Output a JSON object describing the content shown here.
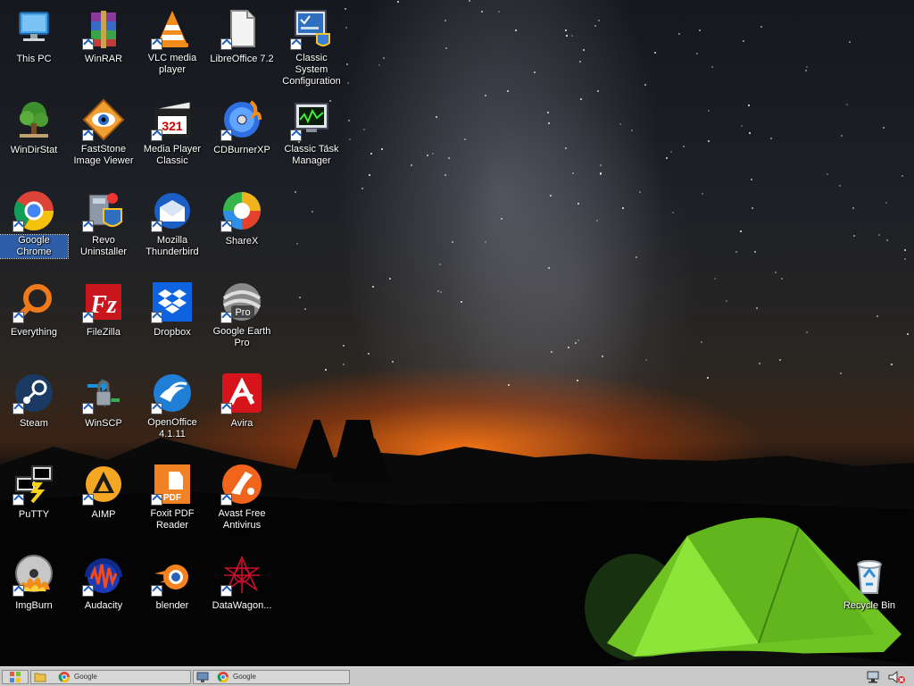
{
  "desktop": {
    "icons": [
      {
        "label": "This PC",
        "name": "this-pc-icon"
      },
      {
        "label": "WinRAR",
        "name": "winrar-icon"
      },
      {
        "label": "VLC media player",
        "name": "vlc-icon"
      },
      {
        "label": "LibreOffice 7.2",
        "name": "libreoffice-icon"
      },
      {
        "label": "Classic System Configuration",
        "name": "classic-system-configuration-icon"
      },
      {
        "label": "WinDirStat",
        "name": "windirstat-icon"
      },
      {
        "label": "FastStone Image Viewer",
        "name": "faststone-icon"
      },
      {
        "label": "Media Player Classic",
        "name": "media-player-classic-icon"
      },
      {
        "label": "CDBurnerXP",
        "name": "cdburnerxp-icon"
      },
      {
        "label": "Classic Task Manager",
        "name": "classic-task-manager-icon"
      },
      {
        "label": "Google Chrome",
        "name": "google-chrome-icon"
      },
      {
        "label": "Revo Uninstaller",
        "name": "revo-uninstaller-icon"
      },
      {
        "label": "Mozilla Thunderbird",
        "name": "thunderbird-icon"
      },
      {
        "label": "ShareX",
        "name": "sharex-icon"
      },
      {
        "label": "Everything",
        "name": "everything-icon"
      },
      {
        "label": "FileZilla",
        "name": "filezilla-icon"
      },
      {
        "label": "Dropbox",
        "name": "dropbox-icon"
      },
      {
        "label": "Google Earth Pro",
        "name": "google-earth-pro-icon"
      },
      {
        "label": "Steam",
        "name": "steam-icon"
      },
      {
        "label": "WinSCP",
        "name": "winscp-icon"
      },
      {
        "label": "OpenOffice 4.1.11",
        "name": "openoffice-icon"
      },
      {
        "label": "Avira",
        "name": "avira-icon"
      },
      {
        "label": "PuTTY",
        "name": "putty-icon"
      },
      {
        "label": "AIMP",
        "name": "aimp-icon"
      },
      {
        "label": "Foxit PDF Reader",
        "name": "foxit-pdf-reader-icon"
      },
      {
        "label": "Avast Free Antivirus",
        "name": "avast-icon"
      },
      {
        "label": "ImgBurn",
        "name": "imgburn-icon"
      },
      {
        "label": "Audacity",
        "name": "audacity-icon"
      },
      {
        "label": "blender",
        "name": "blender-icon"
      },
      {
        "label": "DataWagon...",
        "name": "datawagon-icon"
      },
      {
        "label": "Recycle Bin",
        "name": "recycle-bin-icon"
      }
    ],
    "selected": "Google Chrome"
  },
  "taskbar": {
    "google_badge": "Google",
    "google_badge2": "Google"
  },
  "colors": {
    "selection": "#2f5ea8",
    "taskbar": "#c9c9c9",
    "tent": "#7fd32a",
    "glow": "#ff7a14"
  }
}
